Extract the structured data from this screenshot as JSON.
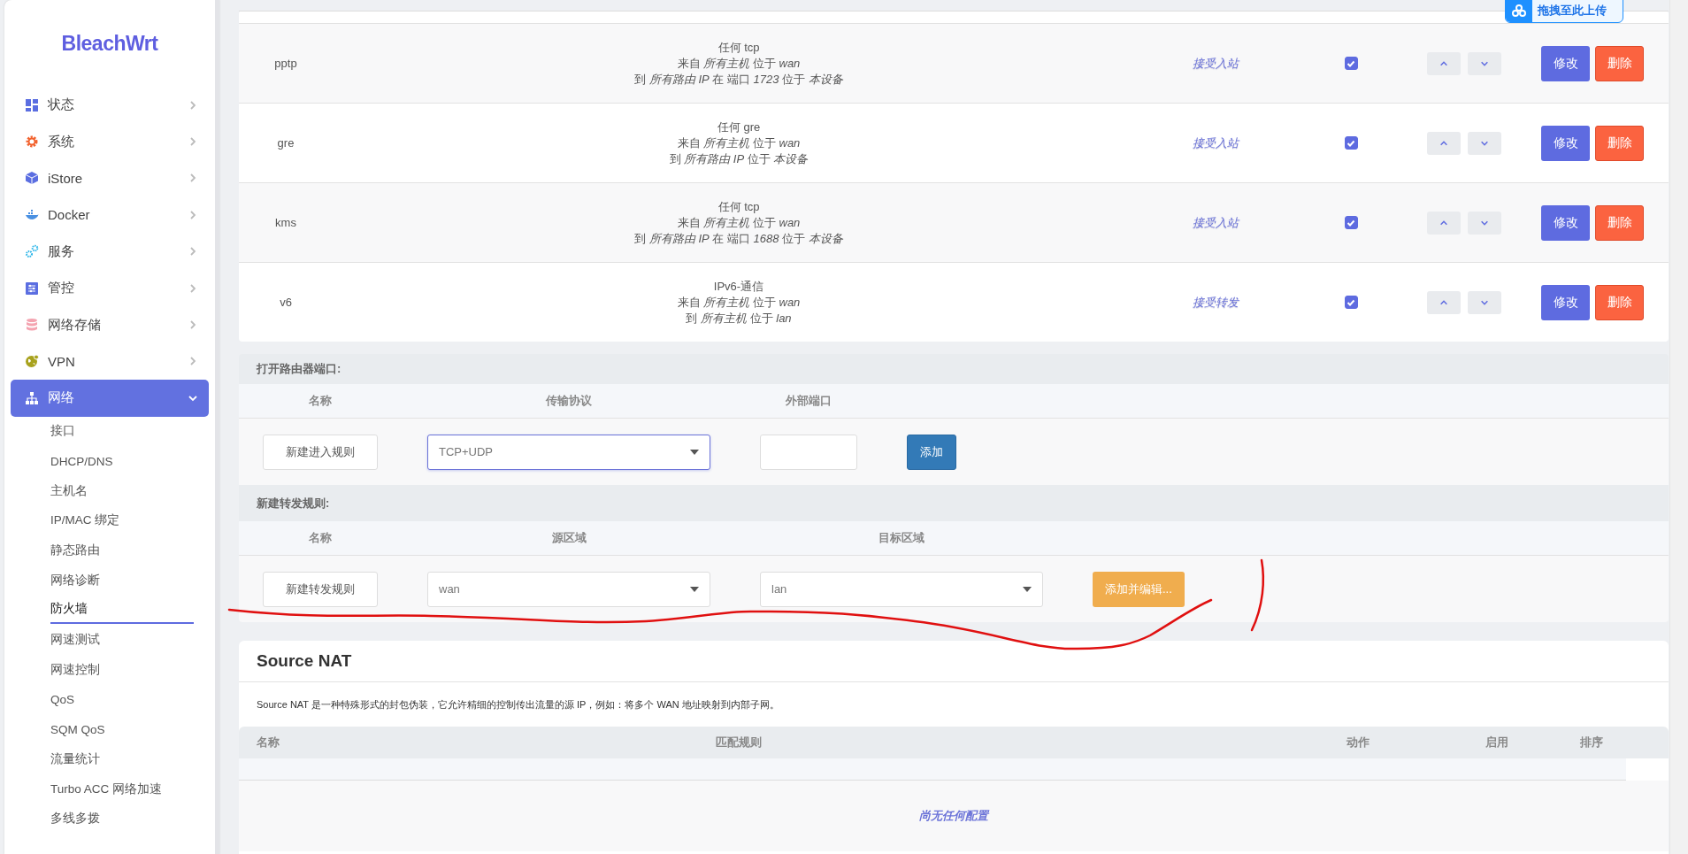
{
  "sidebar": {
    "logo": "BleachWrt",
    "items": [
      {
        "label": "状态",
        "selected": false,
        "expanded": false
      },
      {
        "label": "系统",
        "selected": false,
        "expanded": false
      },
      {
        "label": "iStore",
        "selected": false,
        "expanded": false
      },
      {
        "label": "Docker",
        "selected": false,
        "expanded": false
      },
      {
        "label": "服务",
        "selected": false,
        "expanded": false
      },
      {
        "label": "管控",
        "selected": false,
        "expanded": false
      },
      {
        "label": "网络存储",
        "selected": false,
        "expanded": false
      },
      {
        "label": "VPN",
        "selected": false,
        "expanded": false
      },
      {
        "label": "网络",
        "selected": true,
        "expanded": true,
        "children": [
          {
            "label": "接口",
            "selected": false
          },
          {
            "label": "DHCP/DNS",
            "selected": false
          },
          {
            "label": "主机名",
            "selected": false
          },
          {
            "label": "IP/MAC 绑定",
            "selected": false
          },
          {
            "label": "静态路由",
            "selected": false
          },
          {
            "label": "网络诊断",
            "selected": false
          },
          {
            "label": "防火墙",
            "selected": true
          },
          {
            "label": "网速测试",
            "selected": false
          },
          {
            "label": "网速控制",
            "selected": false
          },
          {
            "label": "QoS",
            "selected": false
          },
          {
            "label": "SQM QoS",
            "selected": false
          },
          {
            "label": "流量统计",
            "selected": false
          },
          {
            "label": "Turbo ACC 网络加速",
            "selected": false
          },
          {
            "label": "多线多拨",
            "selected": false
          }
        ]
      }
    ]
  },
  "upload_badge": {
    "label": "拖拽至此上传"
  },
  "rules": [
    {
      "name": "pptp",
      "match": [
        "任何 tcp",
        "来自 *所有主机* 位于 *wan*",
        "到 *所有路由 IP* 在 端口 *1723* 位于 *本设备*"
      ],
      "action": "接受入站",
      "enabled": true,
      "edit": "修改",
      "delete": "删除"
    },
    {
      "name": "gre",
      "match": [
        "任何 gre",
        "来自 *所有主机* 位于 *wan*",
        "到 *所有路由 IP* 位于 *本设备*"
      ],
      "action": "接受入站",
      "enabled": true,
      "edit": "修改",
      "delete": "删除"
    },
    {
      "name": "kms",
      "match": [
        "任何 tcp",
        "来自 *所有主机* 位于 *wan*",
        "到 *所有路由 IP* 在 端口 *1688* 位于 *本设备*"
      ],
      "action": "接受入站",
      "enabled": true,
      "edit": "修改",
      "delete": "删除"
    },
    {
      "name": "v6",
      "match": [
        "IPv6-通信",
        "来自 *所有主机* 位于 *wan*",
        "到 *所有主机* 位于 *lan*"
      ],
      "action": "接受转发",
      "enabled": true,
      "edit": "修改",
      "delete": "删除"
    }
  ],
  "open_ports": {
    "title": "打开路由器端口:",
    "columns": [
      "名称",
      "传输协议",
      "外部端口"
    ],
    "name_placeholder": "新建进入规则",
    "protocol": "TCP+UDP",
    "button": "添加"
  },
  "new_forward": {
    "title": "新建转发规则:",
    "columns": [
      "名称",
      "源区域",
      "目标区域"
    ],
    "name_placeholder": "新建转发规则",
    "source_zone": "wan",
    "dest_zone": "lan",
    "button": "添加并编辑..."
  },
  "source_nat": {
    "title": "Source NAT",
    "description": "Source NAT 是一种特殊形式的封包伪装，它允许精细的控制传出流量的源 IP，例如：将多个 WAN 地址映射到内部子网。",
    "columns": [
      "名称",
      "匹配规则",
      "动作",
      "启用",
      "排序"
    ],
    "empty_text": "尚无任何配置"
  }
}
